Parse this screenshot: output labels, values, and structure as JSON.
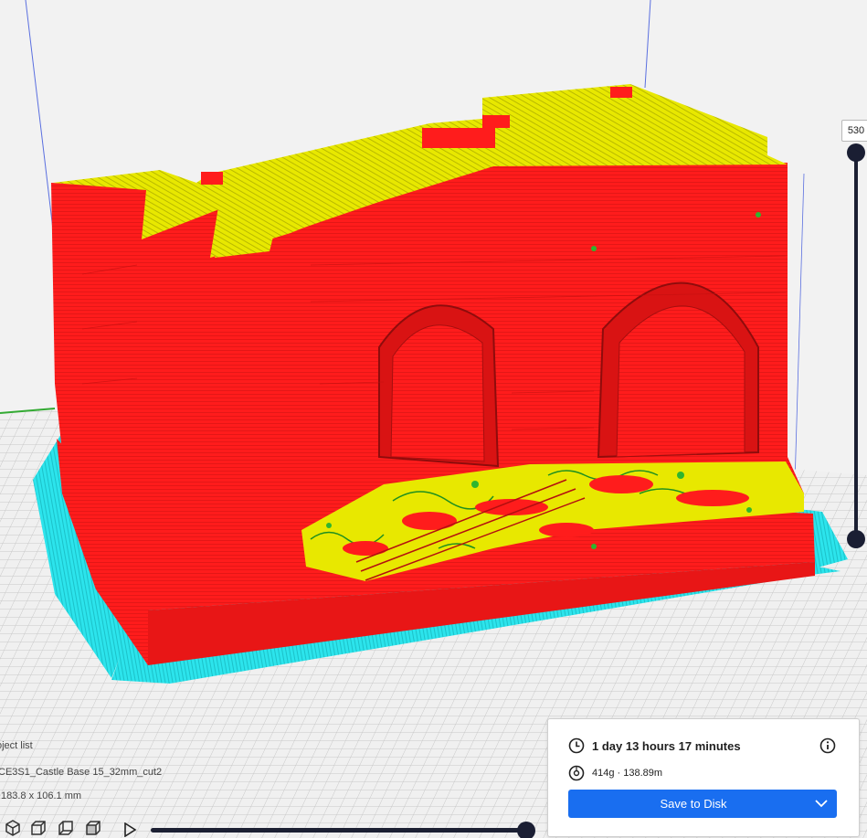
{
  "layer_slider": {
    "current_layer": "530"
  },
  "object_list": {
    "label": "oject list",
    "object_name": "CE3S1_Castle Base 15_32mm_cut2",
    "dimensions": "183.8 x 106.1 mm"
  },
  "view_buttons": [
    {
      "name": "3d-view-icon"
    },
    {
      "name": "front-view-icon"
    },
    {
      "name": "top-view-icon"
    },
    {
      "name": "left-view-icon"
    }
  ],
  "print_panel": {
    "print_time": "1 day 13 hours 17 minutes",
    "material_amount": "414g · 138.89m",
    "save_label": "Save to Disk"
  },
  "colors": {
    "wall": "#ff1c1c",
    "top_skin": "#e6e600",
    "infill_green": "#2fb52f",
    "brim": "#27e0e8",
    "accent_blue": "#196ef0",
    "slider_dark": "#1a1e33",
    "build_plate_grid": "#c8c8c8"
  }
}
